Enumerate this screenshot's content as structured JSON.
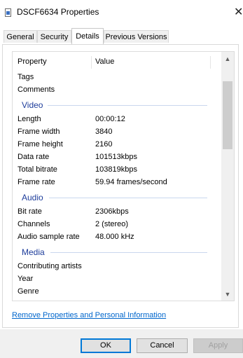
{
  "window": {
    "title": "DSCF6634 Properties",
    "close_glyph": "✕"
  },
  "tabs": [
    "General",
    "Security",
    "Details",
    "Previous Versions"
  ],
  "active_tab": "Details",
  "table": {
    "col_property": "Property",
    "col_value": "Value"
  },
  "rows_top": [
    {
      "k": "Tags",
      "v": ""
    },
    {
      "k": "Comments",
      "v": ""
    }
  ],
  "video": {
    "label": "Video",
    "rows": [
      {
        "k": "Length",
        "v": "00:00:12"
      },
      {
        "k": "Frame width",
        "v": "3840"
      },
      {
        "k": "Frame height",
        "v": "2160"
      },
      {
        "k": "Data rate",
        "v": "101513kbps"
      },
      {
        "k": "Total bitrate",
        "v": "103819kbps"
      },
      {
        "k": "Frame rate",
        "v": "59.94 frames/second"
      }
    ]
  },
  "audio": {
    "label": "Audio",
    "rows": [
      {
        "k": "Bit rate",
        "v": "2306kbps"
      },
      {
        "k": "Channels",
        "v": "2 (stereo)"
      },
      {
        "k": "Audio sample rate",
        "v": "48.000 kHz"
      }
    ]
  },
  "media": {
    "label": "Media",
    "rows": [
      {
        "k": "Contributing artists",
        "v": ""
      },
      {
        "k": "Year",
        "v": ""
      },
      {
        "k": "Genre",
        "v": ""
      }
    ]
  },
  "scrollbar": {
    "up": "▲",
    "down": "▼",
    "position": 0.12
  },
  "remove_link": "Remove Properties and Personal Information",
  "buttons": {
    "ok": "OK",
    "cancel": "Cancel",
    "apply": "Apply"
  },
  "colors": {
    "group_label": "#1e3d9b",
    "link": "#0066cc",
    "focus": "#0078d7"
  }
}
